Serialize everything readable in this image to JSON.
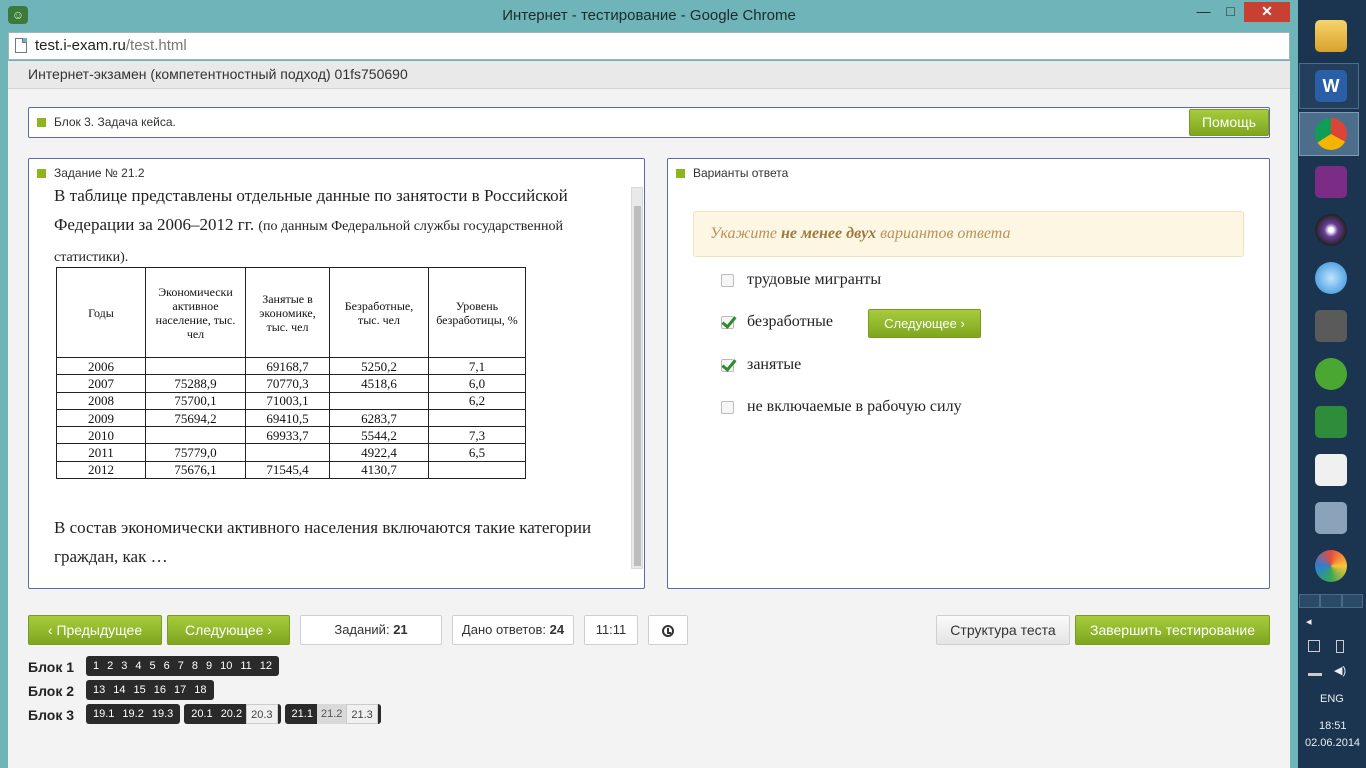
{
  "window": {
    "title": "Интернет - тестирование - Google Chrome",
    "url_host": "test.i-exam.ru",
    "url_path": "/test.html",
    "min": "—",
    "max": "□",
    "close": "✕"
  },
  "exam": {
    "title": "Интернет-экзамен (компетентностный подход) 01fs750690"
  },
  "block_panel": {
    "title": "Блок 3. Задача кейса.",
    "help_label": "Помощь"
  },
  "task": {
    "title": "Задание № 21.2",
    "intro": "В таблице представлены отдельные данные по занятости в Российской Федерации за 2006–2012 гг.",
    "intro_note": "(по данным Федеральной службы государственной статистики).",
    "question": "В состав экономически активного населения включаются такие категории граждан, как …",
    "table": {
      "headers": [
        "Годы",
        "Экономически активное население, тыс. чел",
        "Занятые в экономике, тыс. чел",
        "Безработные, тыс. чел",
        "Уровень безработицы, %"
      ],
      "rows": [
        [
          "2006",
          "",
          "69168,7",
          "5250,2",
          "7,1"
        ],
        [
          "2007",
          "75288,9",
          "70770,3",
          "4518,6",
          "6,0"
        ],
        [
          "2008",
          "75700,1",
          "71003,1",
          "",
          "6,2"
        ],
        [
          "2009",
          "75694,2",
          "69410,5",
          "6283,7",
          ""
        ],
        [
          "2010",
          "",
          "69933,7",
          "5544,2",
          "7,3"
        ],
        [
          "2011",
          "75779,0",
          "",
          "4922,4",
          "6,5"
        ],
        [
          "2012",
          "75676,1",
          "71545,4",
          "4130,7",
          ""
        ]
      ]
    }
  },
  "answers": {
    "title": "Варианты ответа",
    "hint_pre": "Укажите",
    "hint_bold": "не менее двух",
    "hint_post": "вариантов ответа",
    "options": [
      {
        "label": "трудовые мигранты",
        "checked": false
      },
      {
        "label": "безработные",
        "checked": true
      },
      {
        "label": "занятые",
        "checked": true
      },
      {
        "label": "не включаемые в рабочую силу",
        "checked": false
      }
    ],
    "next_label": "Следующее"
  },
  "nav": {
    "prev_label": "Предыдущее",
    "next_label": "Следующее",
    "tasks_label": "Заданий:",
    "tasks_count": "21",
    "answered_label": "Дано ответов:",
    "answered_count": "24",
    "time": "11:11",
    "structure_label": "Структура теста",
    "finish_label": "Завершить тестирование"
  },
  "blocks": [
    {
      "label": "Блок 1",
      "groups": [
        [
          "1",
          "2",
          "3",
          "4",
          "5",
          "6",
          "7",
          "8",
          "9",
          "10",
          "11",
          "12"
        ]
      ]
    },
    {
      "label": "Блок 2",
      "groups": [
        [
          "13",
          "14",
          "15",
          "16",
          "17",
          "18"
        ]
      ]
    },
    {
      "label": "Блок 3",
      "groups": [
        [
          "19.1",
          "19.2",
          "19.3"
        ],
        [
          "20.1",
          "20.2",
          "20.3"
        ],
        [
          "21.1",
          "21.2",
          "21.3"
        ]
      ]
    }
  ],
  "taskbar": {
    "lang": "ENG",
    "time": "18:51",
    "date": "02.06.2014",
    "expand": "◂"
  }
}
